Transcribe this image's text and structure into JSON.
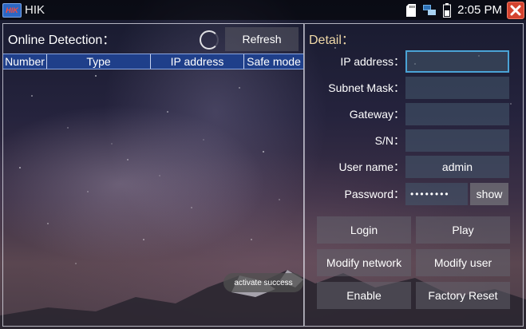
{
  "statusbar": {
    "app_title": "HIK",
    "logo_text": "HIK",
    "time": "2:05 PM",
    "icons": [
      "sd-card-icon",
      "network-icon",
      "battery-icon",
      "close-icon"
    ]
  },
  "online_detection": {
    "title": "Online Detection：",
    "refresh_label": "Refresh",
    "columns": [
      "Number",
      "Type",
      "IP address",
      "Safe mode"
    ],
    "rows": []
  },
  "toast": {
    "message": "activate success"
  },
  "detail": {
    "title": "Detail：",
    "fields": [
      {
        "label": "IP address：",
        "value": ""
      },
      {
        "label": "Subnet Mask：",
        "value": ""
      },
      {
        "label": "Gateway：",
        "value": ""
      },
      {
        "label": "S/N：",
        "value": ""
      },
      {
        "label": "User name：",
        "value": "admin"
      }
    ],
    "password": {
      "label": "Password：",
      "value": "••••••••",
      "show_label": "show"
    },
    "buttons": {
      "login": "Login",
      "play": "Play",
      "modify_network": "Modify network",
      "modify_user": "Modify user",
      "enable": "Enable",
      "factory_reset": "Factory Reset"
    }
  },
  "colors": {
    "table_header": "#1f3f8a",
    "detail_title": "#f0d9a8",
    "focus_border": "#4aa3d6",
    "close_button": "#d4432f"
  }
}
